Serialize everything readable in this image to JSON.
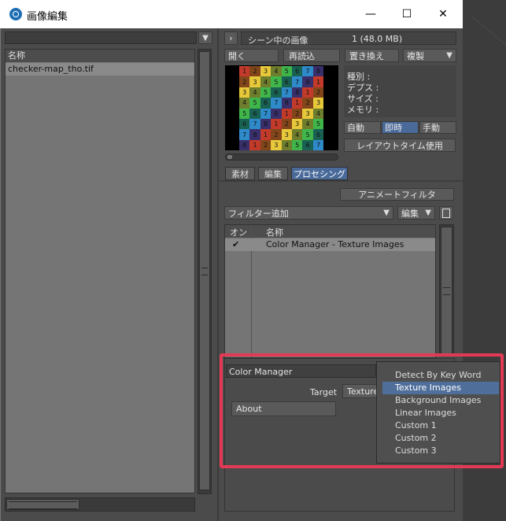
{
  "window": {
    "title": "画像編集",
    "close_glyph": "✕",
    "maximize_glyph": "☐",
    "minimize_glyph": "—"
  },
  "left_pane": {
    "column_header": "名称",
    "files": [
      "checker-map_tho.tif"
    ]
  },
  "right_pane": {
    "expand_glyph": "›",
    "scene_label": "シーン中の画像",
    "scene_count": "1 (48.0 MB)",
    "buttons": {
      "open": "開く",
      "reload": "再読込",
      "replace": "置き換え",
      "duplicate": "複製"
    },
    "info": {
      "type": "種別 :",
      "depth": "デプス :",
      "size": "サイズ :",
      "memory": "メモリ :"
    },
    "update_modes": [
      "自動",
      "即時",
      "手動"
    ],
    "active_update_mode": "即時",
    "layout_time_button": "レイアウトタイム使用",
    "tabs": [
      "素材",
      "編集",
      "プロセシング"
    ],
    "active_tab": "プロセシング",
    "animate_filter_button": "アニメートフィルタ",
    "add_filter": "フィルター追加",
    "edit_dropdown": "編集",
    "filter_table": {
      "headers": [
        "オン",
        "名称"
      ],
      "rows": [
        {
          "on": "✔",
          "name": "Color Manager - Texture Images"
        }
      ]
    }
  },
  "color_manager": {
    "title": "Color Manager",
    "target_label": "Target",
    "target_value": "Texture",
    "about_button": "About",
    "options": [
      "Detect By Key Word",
      "Texture Images",
      "Background Images",
      "Linear Images",
      "Custom 1",
      "Custom 2",
      "Custom 3"
    ],
    "selected": "Texture Images"
  },
  "thumbnail": {
    "rows": [
      [
        "1",
        "2",
        "3",
        "4",
        "5",
        "6",
        "7",
        "8"
      ],
      [
        "2",
        "3",
        "4",
        "5",
        "6",
        "7",
        "8",
        "1"
      ],
      [
        "3",
        "4",
        "5",
        "6",
        "7",
        "8",
        "1",
        "2"
      ],
      [
        "4",
        "5",
        "6",
        "7",
        "8",
        "1",
        "2",
        "3"
      ],
      [
        "5",
        "6",
        "7",
        "8",
        "1",
        "2",
        "3",
        "4"
      ],
      [
        "6",
        "7",
        "8",
        "1",
        "2",
        "3",
        "4",
        "5"
      ],
      [
        "7",
        "8",
        "1",
        "2",
        "3",
        "4",
        "5",
        "6"
      ],
      [
        "8",
        "1",
        "2",
        "3",
        "4",
        "5",
        "6",
        "7"
      ]
    ],
    "palette": [
      "#c23a2a",
      "#d9752b",
      "#e6c83a",
      "#b9d24a",
      "#3fb54a",
      "#2aa38a",
      "#2f8ac9",
      "#5d4fb3"
    ]
  },
  "colors": {
    "accent": "#4a6a9a",
    "highlight_border": "#e33954"
  }
}
